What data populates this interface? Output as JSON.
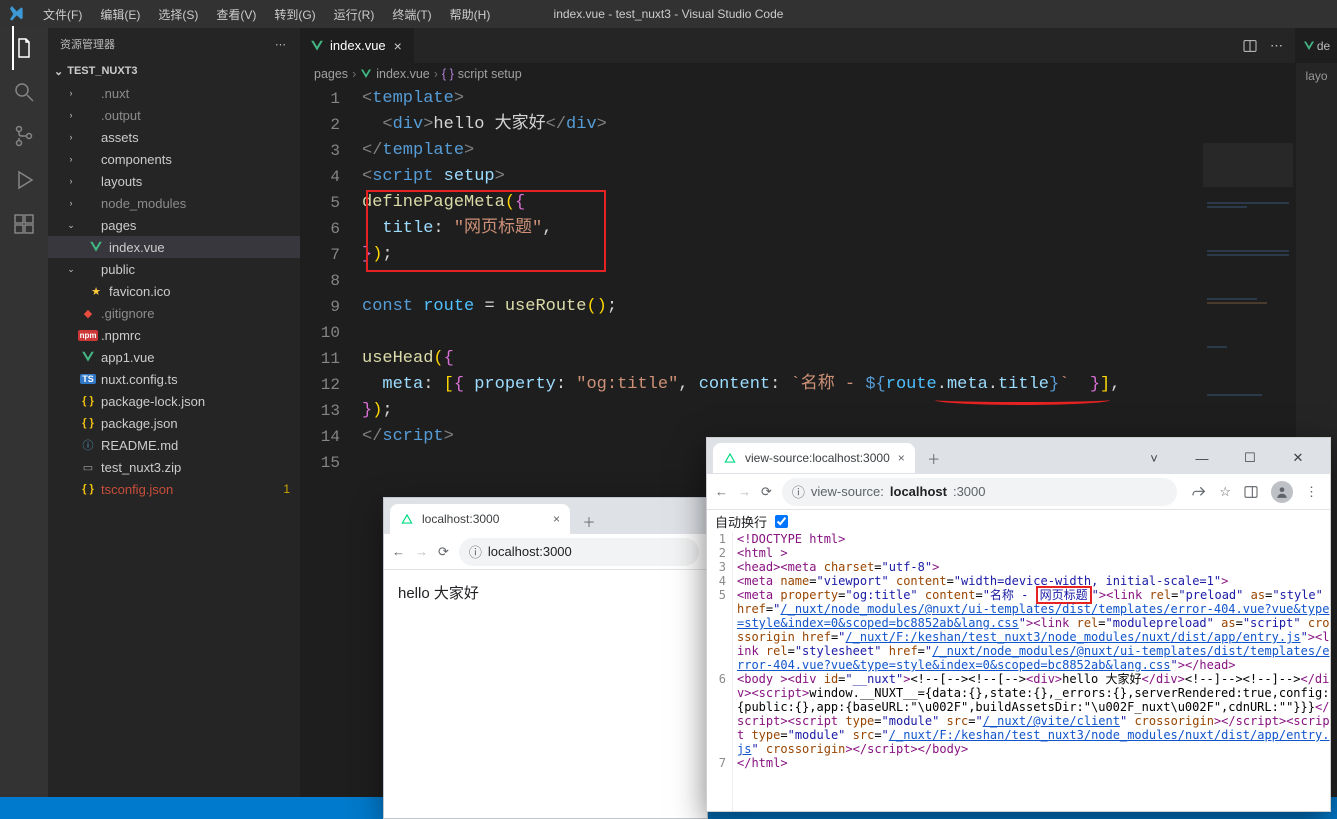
{
  "titlebar": {
    "title": "index.vue - test_nuxt3 - Visual Studio Code",
    "menus": [
      "文件(F)",
      "编辑(E)",
      "选择(S)",
      "查看(V)",
      "转到(G)",
      "运行(R)",
      "终端(T)",
      "帮助(H)"
    ]
  },
  "sidebar": {
    "title": "资源管理器",
    "project": "TEST_NUXT3",
    "tree": [
      {
        "label": ".nuxt",
        "kind": "folder",
        "depth": 1,
        "open": false,
        "dimmed": true
      },
      {
        "label": ".output",
        "kind": "folder",
        "depth": 1,
        "open": false,
        "dimmed": true
      },
      {
        "label": "assets",
        "kind": "folder",
        "depth": 1,
        "open": false
      },
      {
        "label": "components",
        "kind": "folder",
        "depth": 1,
        "open": false
      },
      {
        "label": "layouts",
        "kind": "folder",
        "depth": 1,
        "open": false
      },
      {
        "label": "node_modules",
        "kind": "folder",
        "depth": 1,
        "open": false,
        "dimmed": true
      },
      {
        "label": "pages",
        "kind": "folder",
        "depth": 1,
        "open": true
      },
      {
        "label": "index.vue",
        "kind": "vue",
        "depth": 2,
        "selected": true
      },
      {
        "label": "public",
        "kind": "folder",
        "depth": 1,
        "open": true
      },
      {
        "label": "favicon.ico",
        "kind": "fav",
        "depth": 2
      },
      {
        "label": ".gitignore",
        "kind": "git",
        "depth": 1,
        "dimmed": true
      },
      {
        "label": ".npmrc",
        "kind": "npm",
        "depth": 1
      },
      {
        "label": "app1.vue",
        "kind": "vue",
        "depth": 1
      },
      {
        "label": "nuxt.config.ts",
        "kind": "ts",
        "depth": 1
      },
      {
        "label": "package-lock.json",
        "kind": "json",
        "depth": 1
      },
      {
        "label": "package.json",
        "kind": "json",
        "depth": 1
      },
      {
        "label": "README.md",
        "kind": "md",
        "depth": 1
      },
      {
        "label": "test_nuxt3.zip",
        "kind": "zip",
        "depth": 1
      },
      {
        "label": "tsconfig.json",
        "kind": "json",
        "depth": 1,
        "red": true,
        "badge": "1"
      }
    ]
  },
  "tabs": {
    "active": {
      "label": "index.vue"
    }
  },
  "breadcrumb": {
    "segments": [
      "pages",
      "index.vue",
      "script setup"
    ]
  },
  "code": {
    "lines": [
      {
        "n": 1,
        "html": "<span class='t-bracket'>&lt;</span><span class='t-tag'>template</span><span class='t-bracket'>&gt;</span>"
      },
      {
        "n": 2,
        "html": "  <span class='t-bracket'>&lt;</span><span class='t-tag'>div</span><span class='t-bracket'>&gt;</span><span class='t-txt'>hello 大家好</span><span class='t-bracket'>&lt;/</span><span class='t-tag'>div</span><span class='t-bracket'>&gt;</span>"
      },
      {
        "n": 3,
        "html": "<span class='t-bracket'>&lt;/</span><span class='t-tag'>template</span><span class='t-bracket'>&gt;</span>"
      },
      {
        "n": 4,
        "html": "<span class='t-bracket'>&lt;</span><span class='t-tag'>script</span> <span class='t-attr'>setup</span><span class='t-bracket'>&gt;</span>"
      },
      {
        "n": 5,
        "html": "<span class='t-fn'>definePageMeta</span><span class='t-paren-y'>(</span><span class='t-curly-p'>{</span>"
      },
      {
        "n": 6,
        "html": "  <span class='t-prop'>title</span><span class='t-punc'>:</span> <span class='t-str'>\"网页标题\"</span><span class='t-punc'>,</span>"
      },
      {
        "n": 7,
        "html": "<span class='t-curly-p'>}</span><span class='t-paren-y'>)</span><span class='t-punc'>;</span>"
      },
      {
        "n": 8,
        "html": ""
      },
      {
        "n": 9,
        "html": "<span class='t-kw'>const</span> <span class='t-const'>route</span> <span class='t-punc'>=</span> <span class='t-fn'>useRoute</span><span class='t-paren-y'>()</span><span class='t-punc'>;</span>"
      },
      {
        "n": 10,
        "html": ""
      },
      {
        "n": 11,
        "html": "<span class='t-fn'>useHead</span><span class='t-paren-y'>(</span><span class='t-curly-p'>{</span>"
      },
      {
        "n": 12,
        "html": "  <span class='t-prop'>meta</span><span class='t-punc'>:</span> <span class='t-paren-y'>[</span><span class='t-curly-p'>{</span> <span class='t-prop'>property</span><span class='t-punc'>:</span> <span class='t-str'>\"og:title\"</span><span class='t-punc'>,</span> <span class='t-prop'>content</span><span class='t-punc'>:</span> <span class='t-str'>`名称 - </span><span class='t-kw'>${</span><span class='t-const'>route</span><span class='t-punc'>.</span><span class='t-prop'>meta</span><span class='t-punc'>.</span><span class='t-prop'>title</span><span class='t-kw'>}</span><span class='t-str'>`</span>  <span class='t-curly-p'>}</span><span class='t-paren-y'>]</span><span class='t-punc'>,</span>"
      },
      {
        "n": 13,
        "html": "<span class='t-curly-p'>}</span><span class='t-paren-y'>)</span><span class='t-punc'>;</span>"
      },
      {
        "n": 14,
        "html": "<span class='t-bracket'>&lt;/</span><span class='t-tag'>script</span><span class='t-bracket'>&gt;</span>"
      },
      {
        "n": 15,
        "html": ""
      }
    ]
  },
  "right_split": {
    "tab": "de",
    "label": "layo"
  },
  "browser_small": {
    "tab": "localhost:3000",
    "url": "localhost:3000",
    "body": "hello 大家好"
  },
  "browser_big": {
    "tab": "view-source:localhost:3000",
    "url_pre": "view-source:",
    "url_bold": "localhost",
    "url_post": ":3000",
    "wrap_label": "自动换行",
    "gutter": [
      "1",
      "2",
      "3",
      "4",
      "5",
      "",
      "",
      "",
      "",
      "",
      "6",
      "",
      "",
      "",
      "",
      "",
      "7"
    ],
    "source": [
      "<span class='tg'>&lt;!DOCTYPE html&gt;</span>",
      "<span class='tg'>&lt;html </span><span class='tg'>&gt;</span>",
      "<span class='tg'>&lt;head&gt;</span><span class='tg'>&lt;meta </span><span class='attn'>charset</span>=<span class='attv'>\"utf-8\"</span><span class='tg'>&gt;</span>",
      "<span class='tg'>&lt;meta </span><span class='attn'>name</span>=<span class='attv'>\"viewport\"</span> <span class='attn'>content</span>=<span class='attv'>\"width=device-width, initial-scale=1\"</span><span class='tg'>&gt;</span>",
      "<span class='tg'>&lt;meta </span><span class='attn'>property</span>=<span class='attv'>\"og:title\"</span> <span class='attn'>content</span>=<span class='attv'>\"名称 - <span class='rbox'>网页标题</span>\"</span><span class='tg'>&gt;</span><span class='tg'>&lt;link </span><span class='attn'>rel</span>=<span class='attv'>\"preload\"</span> <span class='attn'>as</span>=<span class='attv'>\"style\"</span> <span class='attn'>href</span>=<span class='attv'>\"</span><span class='lk'>/_nuxt/node_modules/@nuxt/ui-templates/dist/templates/error-404.vue?vue&type=style&index=0&scoped=bc8852ab&lang.css</span><span class='attv'>\"</span><span class='tg'>&gt;</span><span class='tg'>&lt;link </span><span class='attn'>rel</span>=<span class='attv'>\"modulepreload\"</span> <span class='attn'>as</span>=<span class='attv'>\"script\"</span> <span class='attn'>crossorigin</span> <span class='attn'>href</span>=<span class='attv'>\"</span><span class='lk'>/_nuxt/F:/keshan/test_nuxt3/node_modules/nuxt/dist/app/entry.js</span><span class='attv'>\"</span><span class='tg'>&gt;</span><span class='tg'>&lt;link </span><span class='attn'>rel</span>=<span class='attv'>\"stylesheet\"</span> <span class='attn'>href</span>=<span class='attv'>\"</span><span class='lk'>/_nuxt/node_modules/@nuxt/ui-templates/dist/templates/error-404.vue?vue&type=style&index=0&scoped=bc8852ab&lang.css</span><span class='attv'>\"</span><span class='tg'>&gt;</span><span class='tg'>&lt;/head&gt;</span>",
      "<span class='tg'>&lt;body </span><span class='tg'>&gt;</span><span class='tg'>&lt;div </span><span class='attn'>id</span>=<span class='attv'>\"__nuxt\"</span><span class='tg'>&gt;</span><span class='txt'>&lt;!--[--&gt;&lt;!--[--&gt;</span><span class='tg'>&lt;div&gt;</span><span class='txt'>hello 大家好</span><span class='tg'>&lt;/div&gt;</span><span class='txt'>&lt;!--]--&gt;&lt;!--]--&gt;</span><span class='tg'>&lt;/div&gt;</span><span class='tg'>&lt;script&gt;</span><span class='txt'>window.__NUXT__={data:{},state:{},_errors:{},serverRendered:true,config:{public:{},app:{baseURL:\"\\u002F\",buildAssetsDir:\"\\u002F_nuxt\\u002F\",cdnURL:\"\"}}}</span><span class='tg'>&lt;/script&gt;</span><span class='tg'>&lt;script </span><span class='attn'>type</span>=<span class='attv'>\"module\"</span> <span class='attn'>src</span>=<span class='attv'>\"</span><span class='lk'>/_nuxt/@vite/client</span><span class='attv'>\"</span> <span class='attn'>crossorigin</span><span class='tg'>&gt;</span><span class='tg'>&lt;/script&gt;</span><span class='tg'>&lt;script </span><span class='attn'>type</span>=<span class='attv'>\"module\"</span> <span class='attn'>src</span>=<span class='attv'>\"</span><span class='lk'>/_nuxt/F:/keshan/test_nuxt3/node_modules/nuxt/dist/app/entry.js</span><span class='attv'>\"</span> <span class='attn'>crossorigin</span><span class='tg'>&gt;</span><span class='tg'>&lt;/script&gt;</span><span class='tg'>&lt;/body&gt;</span>",
      "<span class='tg'>&lt;/html&gt;</span>"
    ]
  }
}
